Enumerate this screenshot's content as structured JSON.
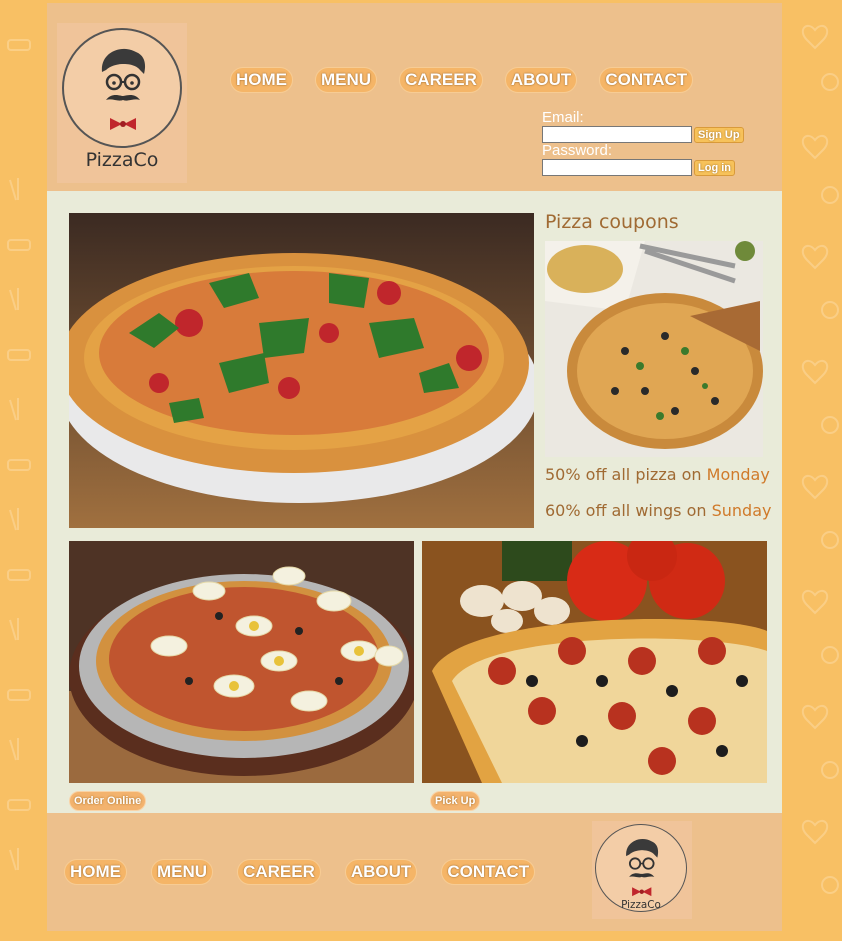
{
  "brand": {
    "logo_text": "PizzaCo"
  },
  "nav": {
    "items": [
      "HOME",
      "MENU",
      "CAREER",
      "ABOUT",
      "CONTACT"
    ]
  },
  "login": {
    "email_label": "Email:",
    "password_label": "Password:",
    "signup_label": "Sign Up",
    "login_label": "Log in"
  },
  "coupons": {
    "title": "Pizza coupons",
    "line1_text": "50% off all pizza on ",
    "line1_day": "Monday",
    "line2_text": "60% off all wings on ",
    "line2_day": "Sunday"
  },
  "actions": {
    "order_online": "Order Online",
    "pick_up": "Pick Up"
  },
  "colors": {
    "page_background": "#f8c064",
    "header_background": "#edc08c",
    "content_background": "#e9ebd9",
    "accent_text": "#a06a33"
  },
  "icons": [
    "pizzaco-mascot-logo"
  ]
}
